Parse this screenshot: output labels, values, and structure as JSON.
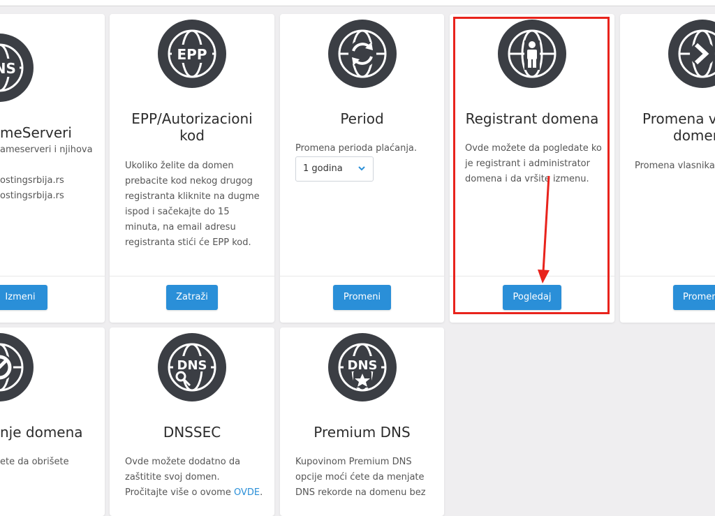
{
  "cards": {
    "nameservers": {
      "icon_text": "DNS",
      "title": "meServeri",
      "desc_lines": [
        "ameserveri i njihova",
        "",
        "ostingsrbija.rs",
        "ostingsrbija.rs"
      ],
      "button": "Izmeni"
    },
    "epp": {
      "icon_text": "EPP",
      "title_line1": "EPP/Autorizacioni",
      "title_line2": "kod",
      "desc_lines": [
        "Ukoliko želite da domen",
        "prebacite kod nekog drugog",
        "registranta kliknite na dugme",
        "ispod i sačekajte do 15",
        "minuta, na email adresu",
        "registranta stići će EPP kod."
      ],
      "button": "Zatraži"
    },
    "period": {
      "title": "Period",
      "desc": "Promena perioda plaćanja.",
      "select_value": "1 godina",
      "button": "Promeni"
    },
    "registrant": {
      "title": "Registrant domena",
      "desc_lines": [
        "Ovde možete da pogledate ko",
        "je registrant i administrator",
        "domena i da vršite izmenu."
      ],
      "button": "Pogledaj"
    },
    "owner_change": {
      "title_line1": "Promena v",
      "title_line2": "domer",
      "desc": "Promena vlasnika",
      "button": "Promer"
    },
    "delete": {
      "title": "nje domena",
      "desc": "ete da obrišete"
    },
    "dnssec": {
      "icon_text": "DNS",
      "title": "DNSSEC",
      "desc_lines": [
        "Ovde možete dodatno da",
        "zaštitite svoj domen."
      ],
      "desc_line3_prefix": "Pročitajte više o ovome ",
      "desc_link": "OVDE",
      "desc_line3_suffix": "."
    },
    "premium_dns": {
      "icon_text": "DNS",
      "title": "Premium DNS",
      "desc_lines": [
        "Kupovinom Premium DNS",
        "opcije moći ćete da menjate",
        "DNS rekorde na domenu bez"
      ]
    }
  },
  "colors": {
    "accent": "#2a8fd8",
    "icon_bg": "#3b3e44",
    "highlight": "#e8231c",
    "page_bg": "#efeef0"
  },
  "icons": [
    "dns-globe-icon",
    "epp-globe-icon",
    "refresh-globe-icon",
    "person-globe-icon",
    "arrow-globe-icon",
    "forbidden-globe-icon",
    "dns-lock-globe-icon",
    "dns-star-globe-icon",
    "chevron-down-icon"
  ]
}
